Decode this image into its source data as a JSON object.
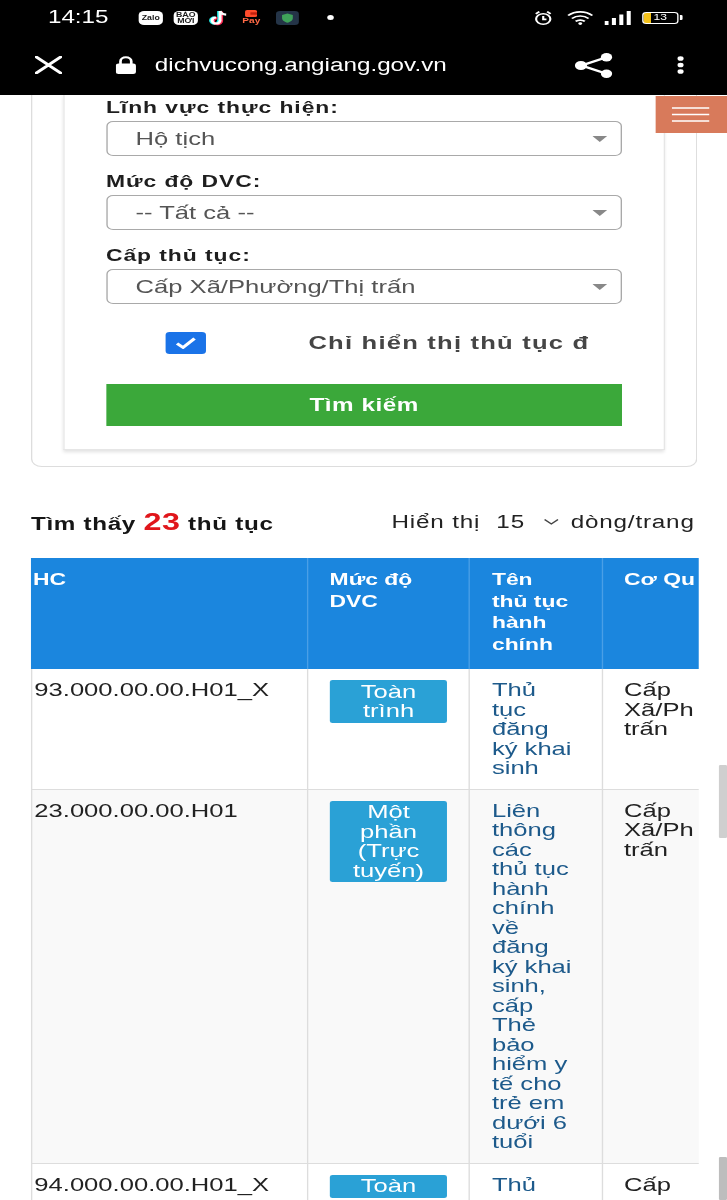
{
  "status_bar": {
    "time": "14:15",
    "notifications": [
      {
        "kind": "tile",
        "label": "Zalo"
      },
      {
        "kind": "tile",
        "label": "BÁO MỚI"
      },
      {
        "kind": "note"
      },
      {
        "kind": "pay",
        "label": "Pay"
      },
      {
        "kind": "shield"
      },
      {
        "kind": "dot"
      }
    ],
    "battery": "13"
  },
  "browser_bar": {
    "url": "dichvucong.angiang.gov.vn"
  },
  "search_form": {
    "fields": [
      {
        "label": "Lĩnh vực thực hiện:",
        "value": "Hộ tịch"
      },
      {
        "label": "Mức độ DVC:",
        "value": "-- Tất cả --"
      },
      {
        "label": "Cấp thủ tục:",
        "value": "Cấp Xã/Phường/Thị trấn"
      }
    ],
    "checkbox": {
      "label": "Chỉ hiển thị thủ tục đ",
      "checked": true
    },
    "button": "Tìm kiếm"
  },
  "results": {
    "summary_before": "Tìm thấy",
    "count": "23",
    "summary_after": "thủ tục",
    "page_size": {
      "label": "Hiển thị",
      "value": "15",
      "unit": "dòng/trang"
    }
  },
  "table": {
    "columns": [
      "HC",
      "Mức độ DVC",
      "Tên thủ tục hành chính",
      "Cơ Qu"
    ],
    "rows": [
      {
        "code": "93.000.00.00.H01_X",
        "level": "Toàn trình",
        "name": "Thủ tục đăng ký khai sinh",
        "agency": "Cấp Xã/Ph trấn"
      },
      {
        "code": "23.000.00.00.H01",
        "level": "Một phần (Trực tuyến)",
        "name": "Liên thông các thủ tục hành chính về đăng ký khai sinh, cấp Thẻ bảo hiểm y tế cho trẻ em dưới 6 tuổi",
        "agency": "Cấp Xã/Ph trấn"
      },
      {
        "code": "94.000.00.00.H01_X",
        "level": "Toàn",
        "name": "Thủ",
        "agency": "Cấp"
      }
    ]
  }
}
